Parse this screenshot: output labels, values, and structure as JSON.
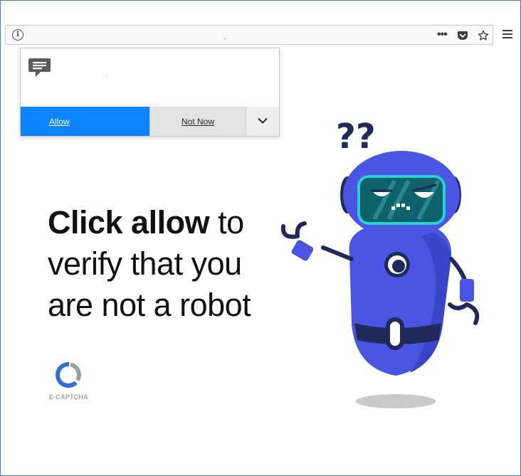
{
  "browser": {
    "info_icon": "info-icon",
    "more_icon": "ellipsis-icon",
    "more_label": "•••",
    "pocket_icon": "pocket-icon",
    "bookmark_icon": "star-icon",
    "menu_icon": "hamburger-menu-icon"
  },
  "permission_prompt": {
    "icon": "message-bubble-icon",
    "allow_label": "Allow",
    "not_now_label": "Not Now",
    "more_options_icon": "chevron-down-icon",
    "colors": {
      "allow": "#0a84ff",
      "not_now": "#e3e3e3"
    }
  },
  "page": {
    "headline_bold": "Click allow",
    "headline_rest": " to verify that you are not a robot",
    "logo_label": "E-CAPTCHA",
    "illustration": "confused-robot-illustration",
    "question_marks": "??",
    "colors": {
      "robot_body": "#4a56e2",
      "robot_dark": "#1f2a5a",
      "visor": "#10626a",
      "visor_outline": "#2ad0d8"
    }
  }
}
